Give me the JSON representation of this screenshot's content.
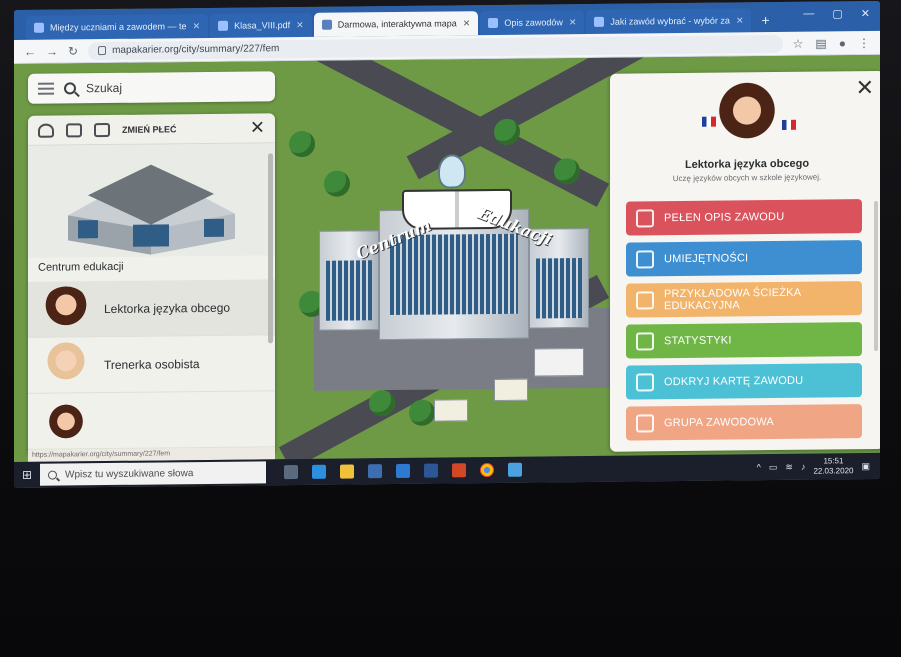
{
  "browser": {
    "tabs": [
      {
        "label": "Między uczniami a zawodem — te",
        "active": false
      },
      {
        "label": "Klasa_VIII.pdf",
        "active": false
      },
      {
        "label": "Darmowa, interaktywna mapa",
        "active": true
      },
      {
        "label": "Opis zawodów",
        "active": false
      },
      {
        "label": "Jaki zawód wybrać - wybór za",
        "active": false
      }
    ],
    "new_tab": "+",
    "url": "mapakarier.org/city/summary/227/fem",
    "status_url": "https://mapakarier.org/city/summary/227/fem"
  },
  "map": {
    "building_label_left": "Centrum",
    "building_label_right": "Edukacji"
  },
  "search": {
    "label": "Szukaj"
  },
  "left_panel": {
    "gender_toggle": "ZMIEŃ PŁEĆ",
    "building_name": "Centrum edukacji",
    "professions": [
      {
        "label": "Lektorka języka obcego"
      },
      {
        "label": "Trenerka osobista"
      }
    ]
  },
  "right_panel": {
    "title": "Lektorka języka obcego",
    "subtitle": "Uczę języków obcych w szkole językowej.",
    "buttons": [
      {
        "label": "PEŁEN OPIS ZAWODU",
        "color": "#d9525c",
        "icon": "document-icon"
      },
      {
        "label": "UMIEJĘTNOŚCI",
        "color": "#3d8fd1",
        "icon": "pencil-icon"
      },
      {
        "label": "PRZYKŁADOWA ŚCIEŻKA EDUKACYJNA",
        "color": "#f2b36a",
        "icon": "path-icon"
      },
      {
        "label": "STATYSTYKI",
        "color": "#6fb646",
        "icon": "chart-icon"
      },
      {
        "label": "ODKRYJ KARTĘ ZAWODU",
        "color": "#4cc1d6",
        "icon": "card-icon"
      },
      {
        "label": "GRUPA ZAWODOWA",
        "color": "#f0a585",
        "icon": "group-icon"
      }
    ]
  },
  "taskbar": {
    "search_placeholder": "Wpisz tu wyszukiwane słowa",
    "time": "15:51",
    "date": "22.03.2020"
  }
}
